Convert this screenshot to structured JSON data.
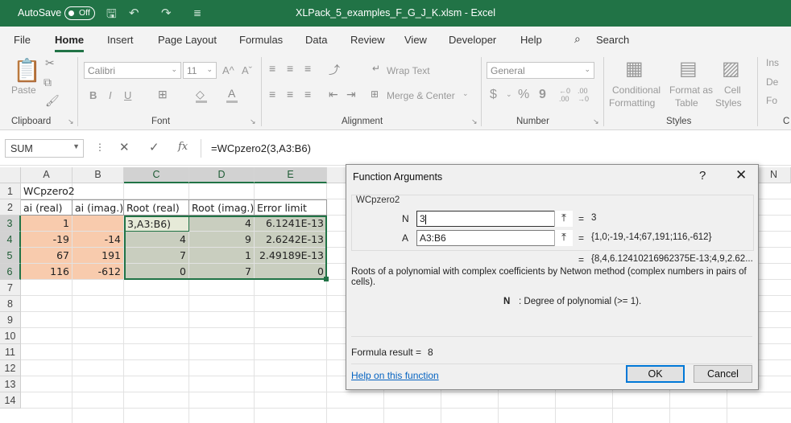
{
  "titlebar": {
    "autosave_label": "AutoSave",
    "autosave_state": "Off",
    "document_title": "XLPack_5_examples_F_G_J_K.xlsm  -  Excel"
  },
  "menu": {
    "tabs": [
      "File",
      "Home",
      "Insert",
      "Page Layout",
      "Formulas",
      "Data",
      "Review",
      "View",
      "Developer",
      "Help"
    ],
    "active_tab": "Home",
    "search_label": "Search"
  },
  "ribbon": {
    "clipboard": {
      "paste_label": "Paste",
      "group_label": "Clipboard"
    },
    "font": {
      "font_name": "Calibri",
      "font_size": "11",
      "bold": "B",
      "italic": "I",
      "underline": "U",
      "grow": "A^",
      "shrink": "Aˇ",
      "group_label": "Font"
    },
    "alignment": {
      "wrap_text": "Wrap Text",
      "merge_center": "Merge & Center",
      "group_label": "Alignment"
    },
    "number": {
      "format": "General",
      "currency": "$",
      "percent": "%",
      "comma": "9",
      "inc_decimal": "←0 .00",
      "dec_decimal": ".00 →0",
      "group_label": "Number"
    },
    "styles": {
      "conditional": "Conditional",
      "conditional_2": "Formatting",
      "format_table": "Format as",
      "format_table_2": "Table",
      "cell_styles": "Cell",
      "cell_styles_2": "Styles",
      "group_label": "Styles"
    },
    "cells": {
      "insert": "Ins",
      "delete": "De",
      "format": "Fo",
      "group_label": "C"
    }
  },
  "formula_bar": {
    "name_box": "SUM",
    "fx": "fx",
    "formula": "=WCpzero2(3,A3:B6)"
  },
  "sheet": {
    "columns": [
      "A",
      "B",
      "C",
      "D",
      "E"
    ],
    "extra_column": "N",
    "rows": [
      "1",
      "2",
      "3",
      "4",
      "5",
      "6",
      "7",
      "8",
      "9",
      "10",
      "11",
      "12",
      "13",
      "14"
    ],
    "title": "WCpzero2",
    "headers": [
      "ai (real)",
      "ai (imag.)",
      "Root (real)",
      "Root (imag.)",
      "Error limit"
    ],
    "data": [
      [
        "1",
        "",
        "3,A3:B6)",
        "4",
        "6.1241E-13"
      ],
      [
        "-19",
        "-14",
        "4",
        "9",
        "2.6242E-13"
      ],
      [
        "67",
        "191",
        "7",
        "1",
        "2.49189E-13"
      ],
      [
        "116",
        "-612",
        "0",
        "7",
        "0"
      ]
    ]
  },
  "dialog": {
    "title": "Function Arguments",
    "help_symbol": "?",
    "close_symbol": "✕",
    "function_name": "WCpzero2",
    "args": [
      {
        "label": "N",
        "value": "3",
        "result": "3"
      },
      {
        "label": "A",
        "value": "A3:B6",
        "result": "{1,0;-19,-14;67,191;116,-612}"
      }
    ],
    "eq": "=",
    "result_preview": "{8,4,6.12410216962375E-13;4,9,2.62...",
    "description": "Roots of a polynomial with complex coefficients by Netwon method (complex numbers in pairs of cells).",
    "arg_help_name": "N",
    "arg_help_text": ": Degree of polynomial (>= 1).",
    "formula_result_label": "Formula result =",
    "formula_result_value": "8",
    "help_link": "Help on this function",
    "ok_label": "OK",
    "cancel_label": "Cancel"
  }
}
